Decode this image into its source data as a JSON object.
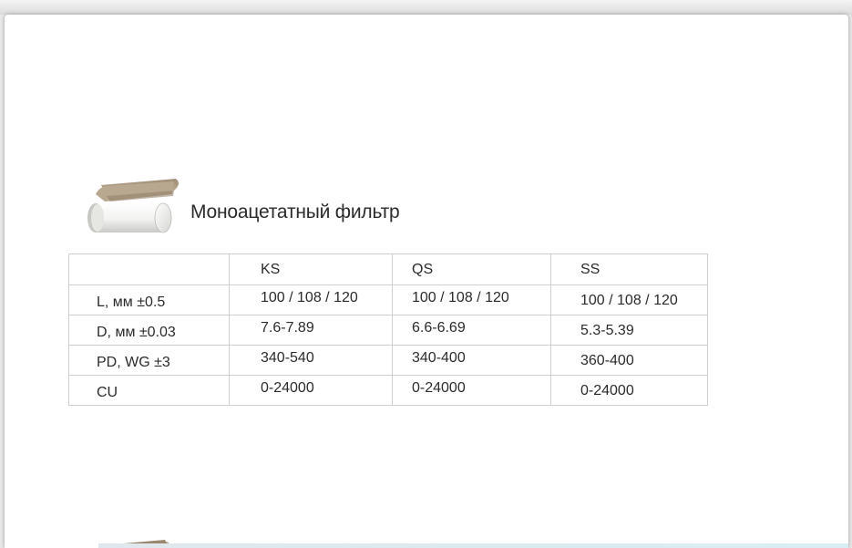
{
  "product": {
    "title": "Моноацетатный фильтр",
    "image_icon": "filter-rod-icon"
  },
  "spec_table": {
    "headers": [
      "",
      "KS",
      "QS",
      "SS"
    ],
    "rows": [
      [
        "L, мм ±0.5",
        "100 / 108 / 120",
        "100 / 108 / 120",
        "100 / 108 / 120"
      ],
      [
        "D, мм ±0.03",
        "7.6-7.89",
        "6.6-6.69",
        "5.3-5.39"
      ],
      [
        "PD, WG ±3",
        "340-540",
        "340-400",
        "360-400"
      ],
      [
        "CU",
        "0-24000",
        "0-24000",
        "0-24000"
      ]
    ]
  },
  "colors": {
    "paper": "#b2a08a",
    "rod": "#f4f4f2",
    "text": "#2b2b2b",
    "border": "#cfcfcf"
  }
}
